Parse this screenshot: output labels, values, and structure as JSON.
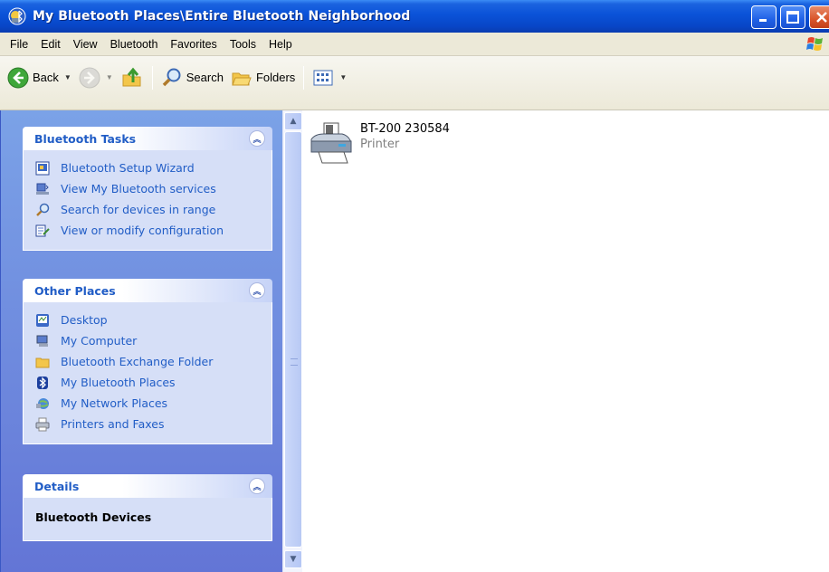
{
  "window": {
    "title": "My Bluetooth Places\\Entire Bluetooth Neighborhood"
  },
  "menu": [
    "File",
    "Edit",
    "View",
    "Bluetooth",
    "Favorites",
    "Tools",
    "Help"
  ],
  "toolbar": {
    "back_label": "Back",
    "search_label": "Search",
    "folders_label": "Folders"
  },
  "tasks_panel": {
    "title": "Bluetooth Tasks",
    "items": [
      {
        "label": "Bluetooth Setup Wizard",
        "icon": "wizard-icon"
      },
      {
        "label": "View My Bluetooth services",
        "icon": "services-icon"
      },
      {
        "label": "Search for devices in range",
        "icon": "search-icon"
      },
      {
        "label": "View or modify configuration",
        "icon": "config-icon"
      }
    ]
  },
  "places_panel": {
    "title": "Other Places",
    "items": [
      {
        "label": "Desktop",
        "icon": "desktop-icon"
      },
      {
        "label": "My Computer",
        "icon": "computer-icon"
      },
      {
        "label": "Bluetooth Exchange Folder",
        "icon": "folder-icon"
      },
      {
        "label": "My Bluetooth Places",
        "icon": "bluetooth-icon"
      },
      {
        "label": "My Network Places",
        "icon": "network-icon"
      },
      {
        "label": "Printers and Faxes",
        "icon": "printer-icon"
      }
    ]
  },
  "details_panel": {
    "title": "Details",
    "heading": "Bluetooth Devices"
  },
  "content": {
    "items": [
      {
        "name": "BT-200 230584",
        "type": "Printer",
        "icon": "printer-icon"
      }
    ]
  },
  "colors": {
    "titlebar": "#0a52d8",
    "task_link": "#215dc6",
    "panel_body": "#d6dff7",
    "left_pane": "#6f8cdd"
  }
}
